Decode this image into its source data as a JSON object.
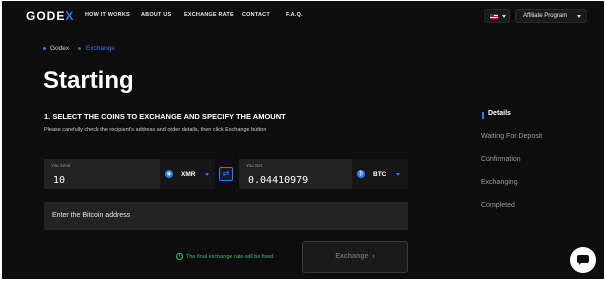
{
  "header": {
    "logo": "GODEX",
    "nav": [
      "HOW IT WORKS",
      "ABOUT US",
      "EXCHANGE RATE",
      "CONTACT",
      "F.A.Q."
    ],
    "affiliate_label": "Affiliate Program"
  },
  "breadcrumb": {
    "home": "Godex",
    "current": "Exchange"
  },
  "page": {
    "title": "Starting",
    "step_heading": "1. SELECT THE COINS TO EXCHANGE AND SPECIFY THE AMOUNT",
    "step_desc": "Please carefully check the recipient's address and order details, then click Exchange button"
  },
  "exchange": {
    "send_label": "You Send",
    "send_value": "10",
    "send_coin": "XMR",
    "get_label": "You Get",
    "get_value": "0.04410979",
    "get_coin": "BTC",
    "address_placeholder": "Enter the  Bitcoin address",
    "fixed_note": "The final exchange rate will be fixed",
    "exchange_button": "Exchange"
  },
  "steps": [
    "Details",
    "Waiting For Deposit",
    "Confirmation",
    "Exchanging",
    "Completed"
  ],
  "colors": {
    "accent": "#2c7cf0",
    "background": "#0d0d0d",
    "success": "#34c26b"
  },
  "icons": {
    "flag": "us-flag-icon",
    "swap": "swap-icon",
    "chat": "chat-icon",
    "info": "info-icon"
  }
}
